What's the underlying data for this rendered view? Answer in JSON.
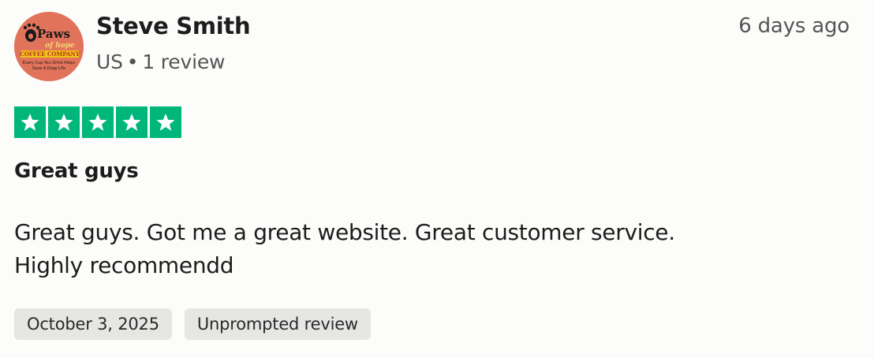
{
  "reviewer": {
    "name": "Steve Smith",
    "country": "US",
    "separator": "•",
    "review_count": "1 review",
    "avatar": {
      "logo_main": "Paws",
      "logo_sub": "of hope",
      "logo_company": "COFFEE COMPANY",
      "logo_tagline_1": "Every Cup You Drink Helps",
      "logo_tagline_2": "Save A Dogs Life",
      "background_color": "#e2735b"
    }
  },
  "timestamp": "6 days ago",
  "rating": {
    "stars": 5,
    "max": 5,
    "color": "#00b67a",
    "icon": "star-icon"
  },
  "review": {
    "title": "Great guys",
    "body_line_1": "Great guys. Got me a great website. Great customer service.",
    "body_line_2": "Highly recommendd"
  },
  "tags": {
    "date": "October 3, 2025",
    "type": "Unprompted review"
  }
}
